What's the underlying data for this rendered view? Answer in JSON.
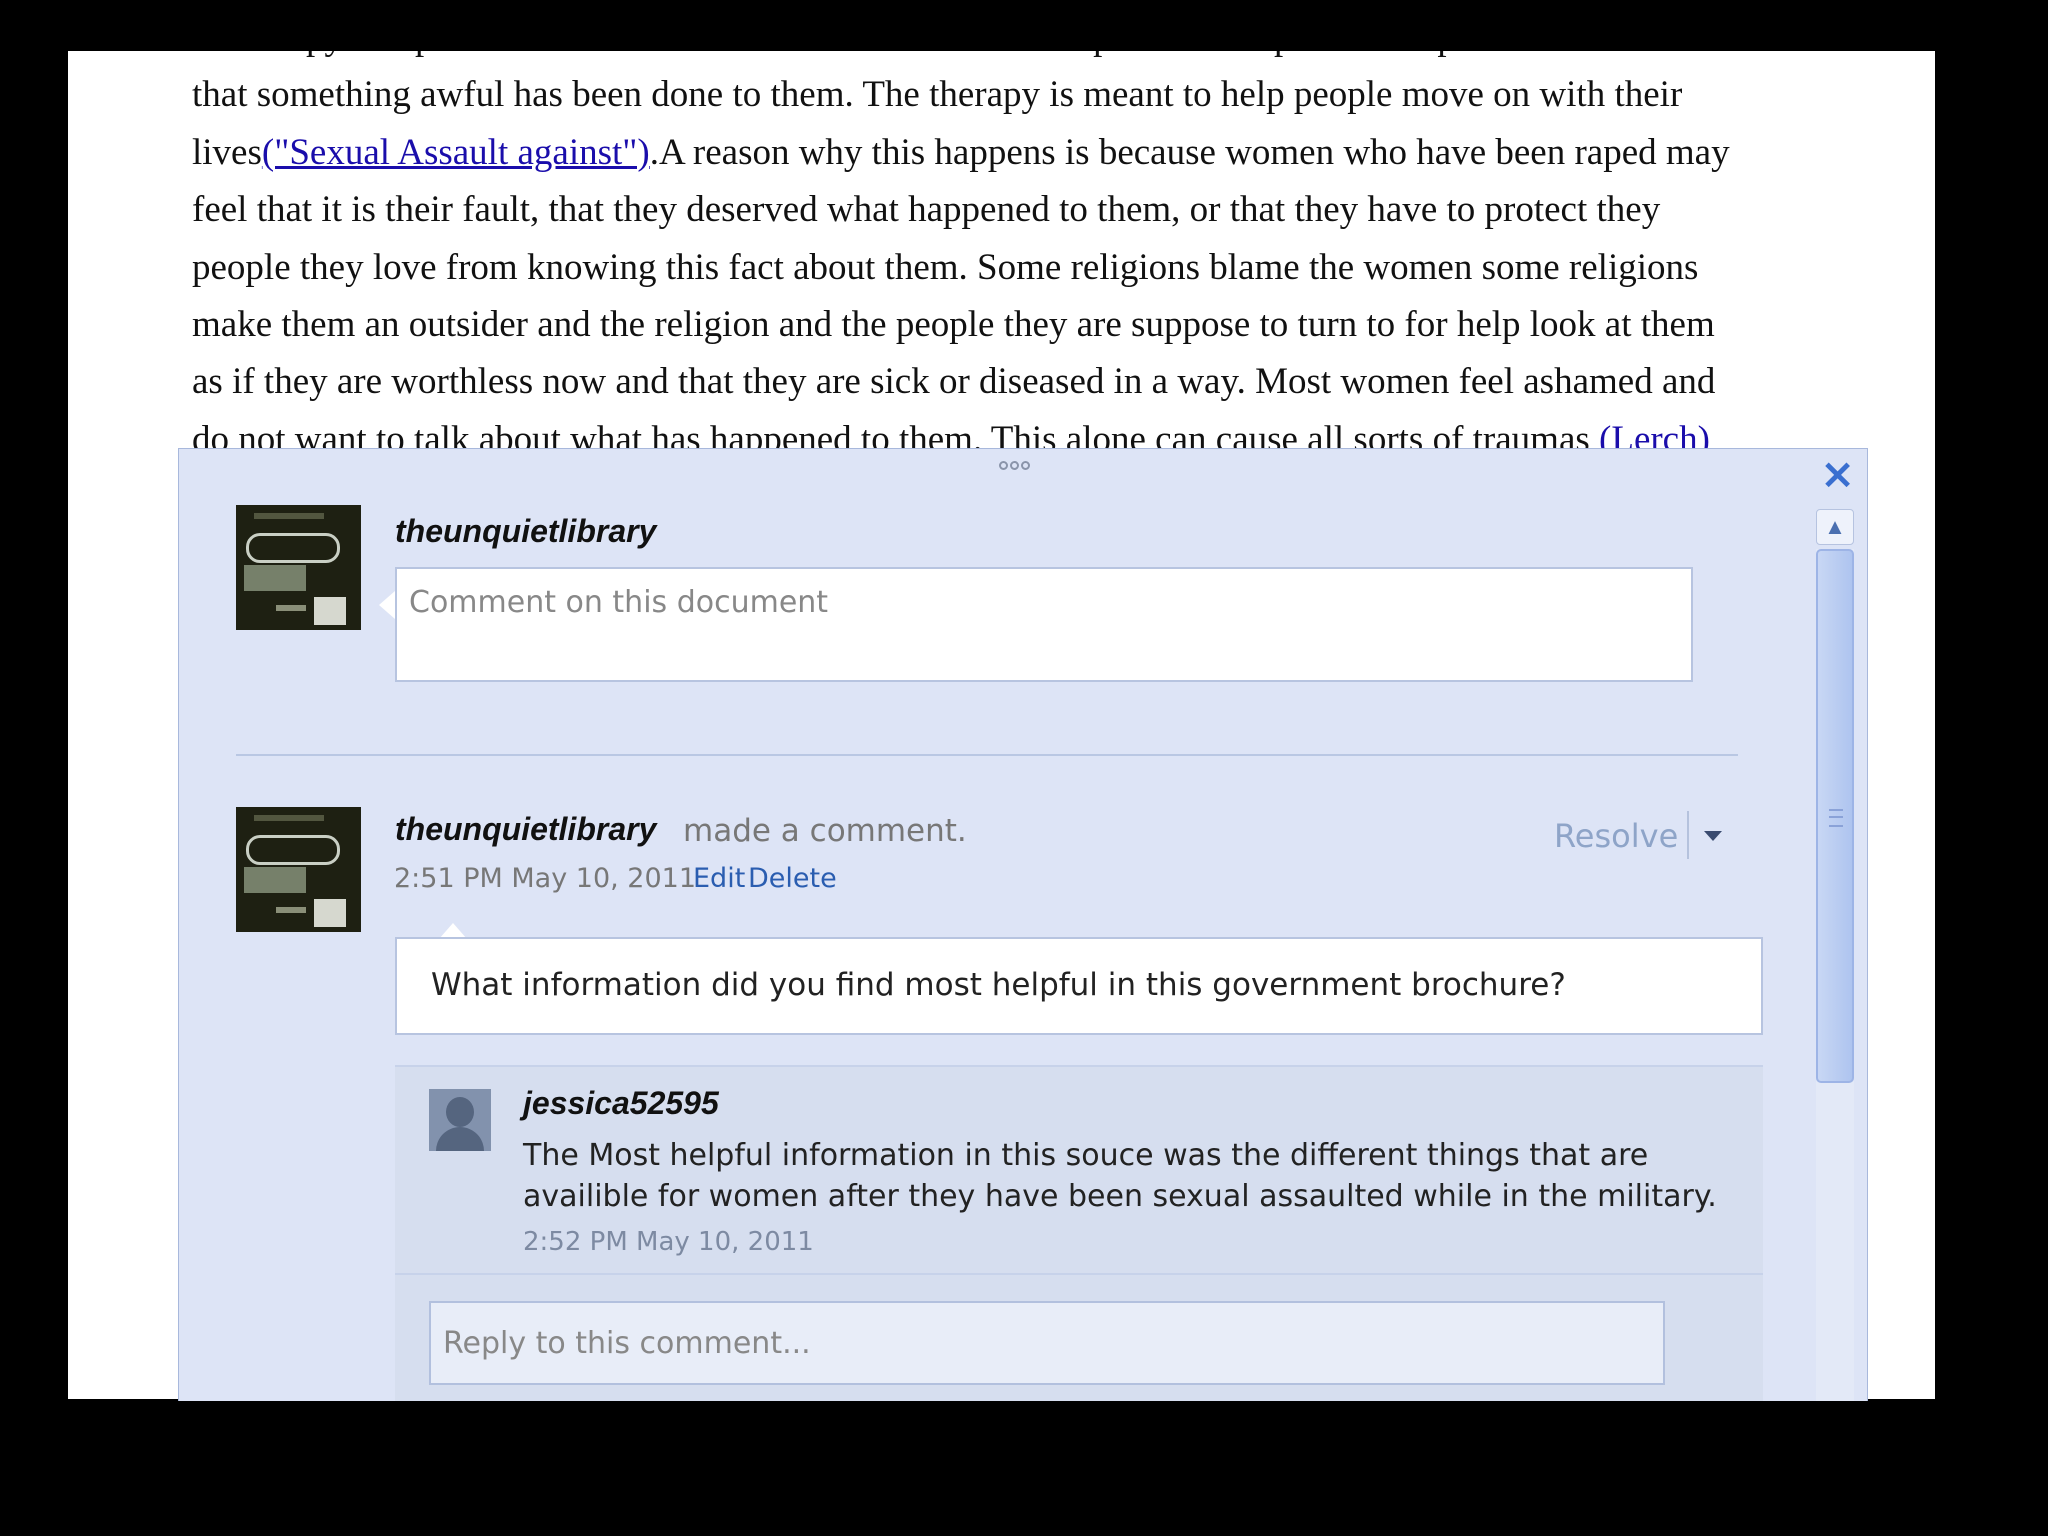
{
  "document": {
    "lines": [
      "of therapy one person would need over the other. Some therapies will help one to cope with life now",
      "that something awful has been done to them. The therapy is meant to help people move on with their",
      {
        "before": "lives",
        "link": "(\"Sexual Assault against\")",
        "after": ".A reason why this happens is because women who have been raped may"
      },
      "feel that it is their fault, that they deserved what happened to them, or that they have to protect they",
      "people they love from knowing this fact about them. Some religions blame the women some religions",
      "make them an outsider and the religion and the people they are suppose to turn to for help look at them",
      "as if they are worthless now and that they are sick or diseased in a way. Most women feel ashamed and",
      {
        "before": "do not want to talk about what has happened to them. This alone can cause all sorts of traumas ",
        "link": "(Lerch)",
        "after": ""
      }
    ]
  },
  "panel": {
    "close_icon": "×",
    "scroll_up_icon": "▲",
    "new_comment": {
      "user": "theunquietlibrary",
      "placeholder": "Comment on this document"
    },
    "comment": {
      "user": "theunquietlibrary",
      "action": "made a comment.",
      "timestamp": "2:51 PM May 10, 2011",
      "edit_label": "Edit",
      "delete_label": "Delete",
      "resolve_label": "Resolve",
      "text": "What information did you find most helpful in this government brochure?"
    },
    "reply": {
      "user": "jessica52595",
      "text": "The Most helpful information in this souce was the different things that are availible for women after they have been sexual assaulted while in the military.",
      "timestamp": "2:52 PM May 10, 2011"
    },
    "reply_box": {
      "placeholder": "Reply to this comment..."
    }
  },
  "colors": {
    "panel_bg": "#dde4f6",
    "link": "#2a5db0",
    "doc_link": "#1a0dab"
  }
}
